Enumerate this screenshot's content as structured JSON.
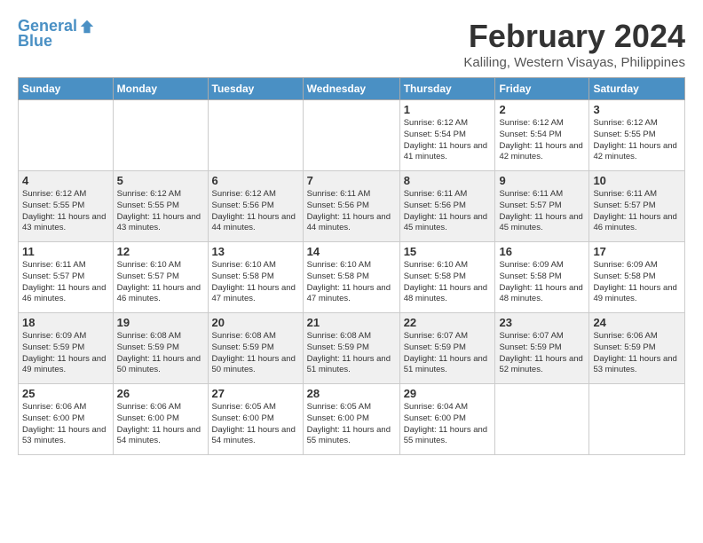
{
  "header": {
    "logo_line1": "General",
    "logo_line2": "Blue",
    "month_year": "February 2024",
    "location": "Kaliling, Western Visayas, Philippines"
  },
  "days_of_week": [
    "Sunday",
    "Monday",
    "Tuesday",
    "Wednesday",
    "Thursday",
    "Friday",
    "Saturday"
  ],
  "weeks": [
    [
      {
        "day": "",
        "info": ""
      },
      {
        "day": "",
        "info": ""
      },
      {
        "day": "",
        "info": ""
      },
      {
        "day": "",
        "info": ""
      },
      {
        "day": "1",
        "info": "Sunrise: 6:12 AM\nSunset: 5:54 PM\nDaylight: 11 hours\nand 41 minutes."
      },
      {
        "day": "2",
        "info": "Sunrise: 6:12 AM\nSunset: 5:54 PM\nDaylight: 11 hours\nand 42 minutes."
      },
      {
        "day": "3",
        "info": "Sunrise: 6:12 AM\nSunset: 5:55 PM\nDaylight: 11 hours\nand 42 minutes."
      }
    ],
    [
      {
        "day": "4",
        "info": "Sunrise: 6:12 AM\nSunset: 5:55 PM\nDaylight: 11 hours\nand 43 minutes."
      },
      {
        "day": "5",
        "info": "Sunrise: 6:12 AM\nSunset: 5:55 PM\nDaylight: 11 hours\nand 43 minutes."
      },
      {
        "day": "6",
        "info": "Sunrise: 6:12 AM\nSunset: 5:56 PM\nDaylight: 11 hours\nand 44 minutes."
      },
      {
        "day": "7",
        "info": "Sunrise: 6:11 AM\nSunset: 5:56 PM\nDaylight: 11 hours\nand 44 minutes."
      },
      {
        "day": "8",
        "info": "Sunrise: 6:11 AM\nSunset: 5:56 PM\nDaylight: 11 hours\nand 45 minutes."
      },
      {
        "day": "9",
        "info": "Sunrise: 6:11 AM\nSunset: 5:57 PM\nDaylight: 11 hours\nand 45 minutes."
      },
      {
        "day": "10",
        "info": "Sunrise: 6:11 AM\nSunset: 5:57 PM\nDaylight: 11 hours\nand 46 minutes."
      }
    ],
    [
      {
        "day": "11",
        "info": "Sunrise: 6:11 AM\nSunset: 5:57 PM\nDaylight: 11 hours\nand 46 minutes."
      },
      {
        "day": "12",
        "info": "Sunrise: 6:10 AM\nSunset: 5:57 PM\nDaylight: 11 hours\nand 46 minutes."
      },
      {
        "day": "13",
        "info": "Sunrise: 6:10 AM\nSunset: 5:58 PM\nDaylight: 11 hours\nand 47 minutes."
      },
      {
        "day": "14",
        "info": "Sunrise: 6:10 AM\nSunset: 5:58 PM\nDaylight: 11 hours\nand 47 minutes."
      },
      {
        "day": "15",
        "info": "Sunrise: 6:10 AM\nSunset: 5:58 PM\nDaylight: 11 hours\nand 48 minutes."
      },
      {
        "day": "16",
        "info": "Sunrise: 6:09 AM\nSunset: 5:58 PM\nDaylight: 11 hours\nand 48 minutes."
      },
      {
        "day": "17",
        "info": "Sunrise: 6:09 AM\nSunset: 5:58 PM\nDaylight: 11 hours\nand 49 minutes."
      }
    ],
    [
      {
        "day": "18",
        "info": "Sunrise: 6:09 AM\nSunset: 5:59 PM\nDaylight: 11 hours\nand 49 minutes."
      },
      {
        "day": "19",
        "info": "Sunrise: 6:08 AM\nSunset: 5:59 PM\nDaylight: 11 hours\nand 50 minutes."
      },
      {
        "day": "20",
        "info": "Sunrise: 6:08 AM\nSunset: 5:59 PM\nDaylight: 11 hours\nand 50 minutes."
      },
      {
        "day": "21",
        "info": "Sunrise: 6:08 AM\nSunset: 5:59 PM\nDaylight: 11 hours\nand 51 minutes."
      },
      {
        "day": "22",
        "info": "Sunrise: 6:07 AM\nSunset: 5:59 PM\nDaylight: 11 hours\nand 51 minutes."
      },
      {
        "day": "23",
        "info": "Sunrise: 6:07 AM\nSunset: 5:59 PM\nDaylight: 11 hours\nand 52 minutes."
      },
      {
        "day": "24",
        "info": "Sunrise: 6:06 AM\nSunset: 5:59 PM\nDaylight: 11 hours\nand 53 minutes."
      }
    ],
    [
      {
        "day": "25",
        "info": "Sunrise: 6:06 AM\nSunset: 6:00 PM\nDaylight: 11 hours\nand 53 minutes."
      },
      {
        "day": "26",
        "info": "Sunrise: 6:06 AM\nSunset: 6:00 PM\nDaylight: 11 hours\nand 54 minutes."
      },
      {
        "day": "27",
        "info": "Sunrise: 6:05 AM\nSunset: 6:00 PM\nDaylight: 11 hours\nand 54 minutes."
      },
      {
        "day": "28",
        "info": "Sunrise: 6:05 AM\nSunset: 6:00 PM\nDaylight: 11 hours\nand 55 minutes."
      },
      {
        "day": "29",
        "info": "Sunrise: 6:04 AM\nSunset: 6:00 PM\nDaylight: 11 hours\nand 55 minutes."
      },
      {
        "day": "",
        "info": ""
      },
      {
        "day": "",
        "info": ""
      }
    ]
  ]
}
